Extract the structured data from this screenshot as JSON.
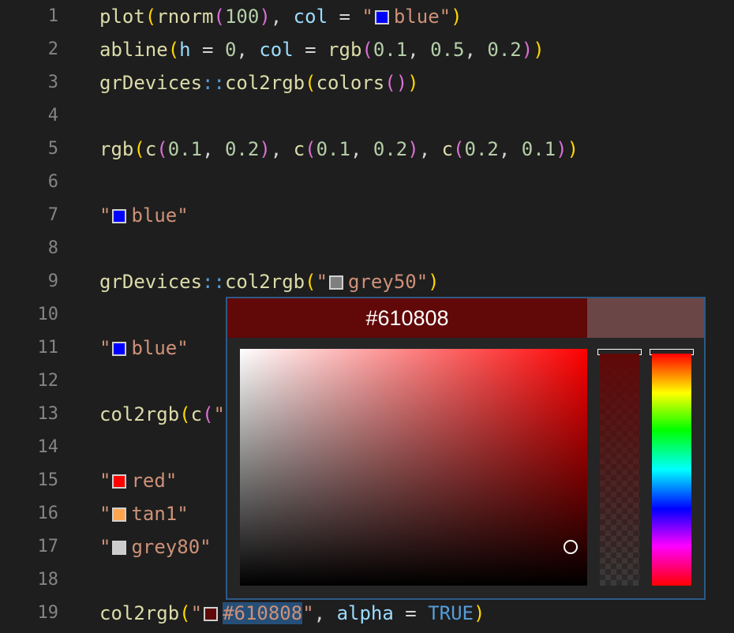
{
  "editor": {
    "line_numbers": [
      "1",
      "2",
      "3",
      "4",
      "5",
      "6",
      "7",
      "8",
      "9",
      "10",
      "11",
      "12",
      "13",
      "14",
      "15",
      "16",
      "17",
      "18",
      "19"
    ],
    "l1": {
      "fn": "plot",
      "fn2": "rnorm",
      "n": "100",
      "arg": "col",
      "eq": "=",
      "str": "blue",
      "swatch": "#0000ff"
    },
    "l2": {
      "fn": "abline",
      "a1": "h",
      "v1": "0",
      "a2": "col",
      "fn2": "rgb",
      "v2": "0.1",
      "v3": "0.5",
      "v4": "0.2"
    },
    "l3": {
      "ns": "grDevices",
      "sep": "::",
      "fn": "col2rgb",
      "fn2": "colors"
    },
    "l5": {
      "fn": "rgb",
      "c": "c",
      "v1": "0.1",
      "v2": "0.2",
      "v3": "0.1",
      "v4": "0.2",
      "v5": "0.2",
      "v6": "0.1"
    },
    "l7": {
      "str": "blue",
      "swatch": "#0000ff"
    },
    "l9": {
      "ns": "grDevices",
      "sep": "::",
      "fn": "col2rgb",
      "str": "grey50",
      "swatch": "#7f7f7f"
    },
    "l11": {
      "str": "blue",
      "swatch": "#0000ff"
    },
    "l13": {
      "fn": "col2rgb",
      "c": "c"
    },
    "l15": {
      "str": "red",
      "swatch": "#ff0000"
    },
    "l16": {
      "str": "tan1",
      "swatch": "#ffa54f"
    },
    "l17": {
      "str": "grey80",
      "swatch": "#cccccc"
    },
    "l19": {
      "fn": "col2rgb",
      "str": "#610808",
      "arg": "alpha",
      "eq": "=",
      "kw": "TRUE",
      "swatch": "#610808"
    }
  },
  "color_picker": {
    "current_hex": "#610808",
    "current_color": "#610808",
    "original_color": "#6b4646",
    "hue_color": "#ff0000"
  }
}
